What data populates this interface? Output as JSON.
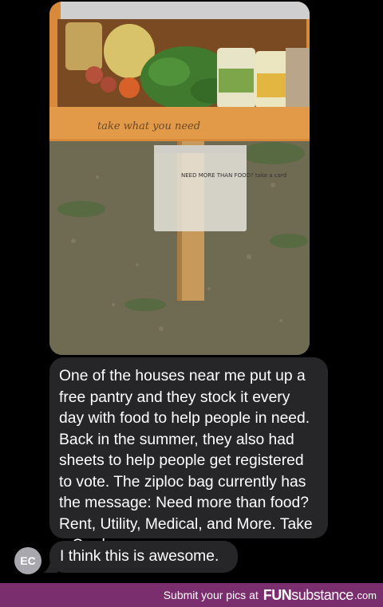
{
  "messages": {
    "photo_alt": "",
    "bag_note": "NEED MORE THAN FOOD? take a card",
    "box_sign": "take what you need",
    "main_text": "One of the houses near me put up a free pantry and they stock it every day with food to help people in need. Back in the summer, they also had sheets to help people get registered to vote. The ziploc bag currently has the message: Need more than food? Rent, Utility, Medical, and More. Take a Card.",
    "reply_text": "I think this is awesome."
  },
  "sender": {
    "initials": "EC"
  },
  "footer": {
    "cta": "Submit your pics at",
    "brand_fun": "FUN",
    "brand_substance": "substance",
    "brand_tld": ".com"
  },
  "colors": {
    "background": "#000000",
    "bubble": "#262628",
    "footer": "#7a2e6e"
  }
}
